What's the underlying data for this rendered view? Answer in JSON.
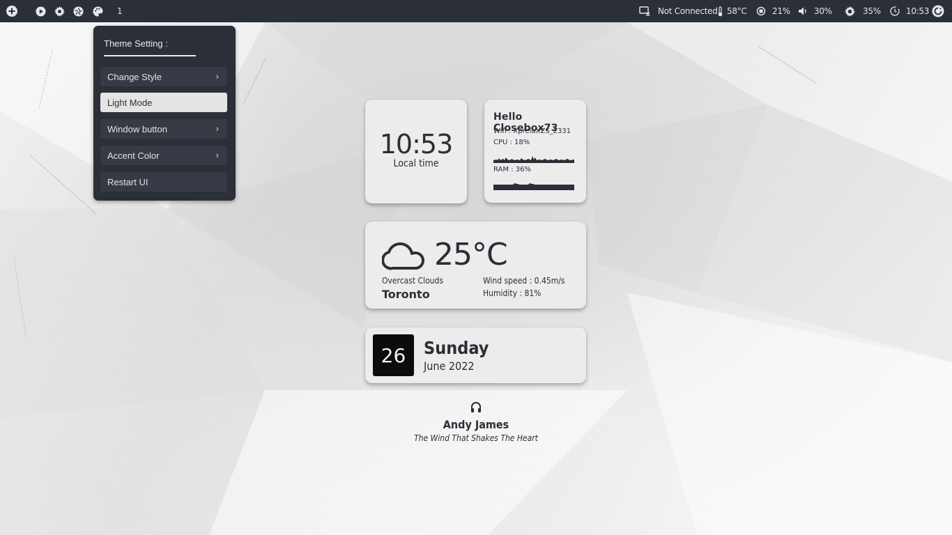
{
  "topbar": {
    "left_icons": [
      "add-icon",
      "play-icon",
      "gear-icon",
      "aperture-icon",
      "palette-icon"
    ],
    "workspace": "1",
    "network": {
      "icon": "network-disconnected-icon",
      "label": "Not Connected"
    },
    "temperature": {
      "icon": "thermometer-icon",
      "label": "58°C"
    },
    "cpu": {
      "icon": "cpu-icon",
      "label": "21%"
    },
    "volume": {
      "icon": "speaker-icon",
      "label": "30%"
    },
    "brightness": {
      "icon": "brightness-icon",
      "label": "35%"
    },
    "clock": {
      "icon": "clock-icon",
      "label": "10:53"
    },
    "power_icon": "power-icon"
  },
  "theme_menu": {
    "title": "Theme Setting :",
    "items": [
      {
        "label": "Change Style",
        "chevron": "›",
        "active": false
      },
      {
        "label": "Light Mode",
        "chevron": "",
        "active": true
      },
      {
        "label": "Window button",
        "chevron": "›",
        "active": false
      },
      {
        "label": "Accent Color",
        "chevron": "›",
        "active": false
      },
      {
        "label": "Restart UI",
        "chevron": "",
        "active": false
      }
    ]
  },
  "clock_widget": {
    "time": "10:53",
    "label": "Local time"
  },
  "system_widget": {
    "greeting": "Hello Closebox73",
    "wifi": "Wifi :  XpreiaXZS_2331",
    "cpu": "CPU : 18%",
    "ram": "RAM : 36%"
  },
  "weather_widget": {
    "icon": "cloud-icon",
    "temperature": "25°C",
    "description": "Overcast Clouds",
    "city": "Toronto",
    "wind": "Wind speed : 0.45m/s",
    "humidity": "Humidity : 81%"
  },
  "date_widget": {
    "day_number": "26",
    "weekday": "Sunday",
    "month_year": "June 2022"
  },
  "music_widget": {
    "icon": "headphones-icon",
    "artist": "Andy James",
    "title": "The Wind That Shakes The Heart"
  },
  "colors": {
    "panel": "#2b2f38",
    "card": "#ececec",
    "text": "#2b2e36",
    "date_box": "#0c0c0c"
  }
}
